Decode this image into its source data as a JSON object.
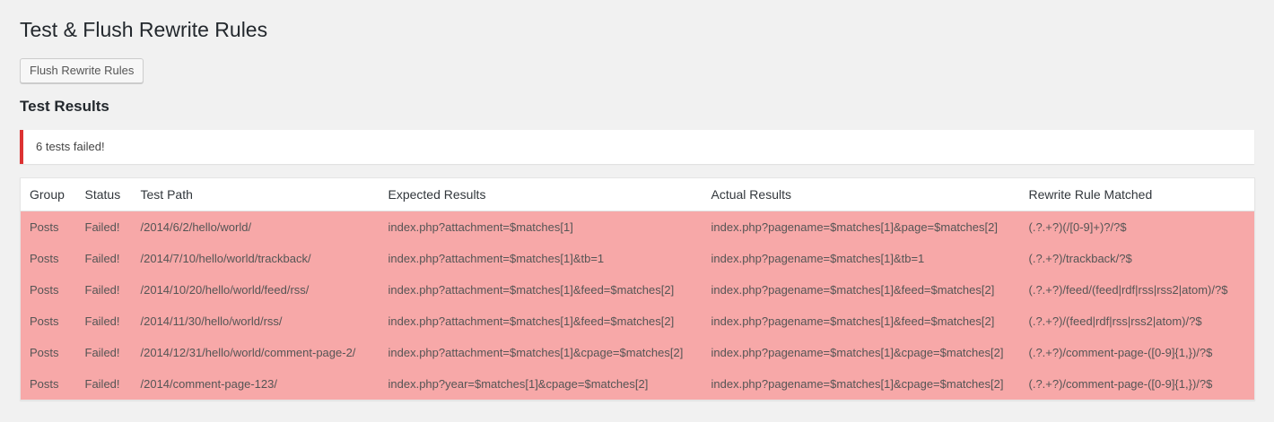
{
  "page": {
    "title": "Test & Flush Rewrite Rules",
    "flush_button_label": "Flush Rewrite Rules",
    "section_title": "Test Results"
  },
  "notice": {
    "message": "6 tests failed!",
    "color": "#dc3232"
  },
  "table": {
    "row_color": "#f7a8a8",
    "columns": [
      "Group",
      "Status",
      "Test Path",
      "Expected Results",
      "Actual Results",
      "Rewrite Rule Matched"
    ],
    "rows": [
      [
        "Posts",
        "Failed!",
        "/2014/6/2/hello/world/",
        "index.php?attachment=$matches[1]",
        "index.php?pagename=$matches[1]&page=$matches[2]",
        "(.?.+?)(/[0-9]+)?/?$"
      ],
      [
        "Posts",
        "Failed!",
        "/2014/7/10/hello/world/trackback/",
        "index.php?attachment=$matches[1]&tb=1",
        "index.php?pagename=$matches[1]&tb=1",
        "(.?.+?)/trackback/?$"
      ],
      [
        "Posts",
        "Failed!",
        "/2014/10/20/hello/world/feed/rss/",
        "index.php?attachment=$matches[1]&feed=$matches[2]",
        "index.php?pagename=$matches[1]&feed=$matches[2]",
        "(.?.+?)/feed/(feed|rdf|rss|rss2|atom)/?$"
      ],
      [
        "Posts",
        "Failed!",
        "/2014/11/30/hello/world/rss/",
        "index.php?attachment=$matches[1]&feed=$matches[2]",
        "index.php?pagename=$matches[1]&feed=$matches[2]",
        "(.?.+?)/(feed|rdf|rss|rss2|atom)/?$"
      ],
      [
        "Posts",
        "Failed!",
        "/2014/12/31/hello/world/comment-page-2/",
        "index.php?attachment=$matches[1]&cpage=$matches[2]",
        "index.php?pagename=$matches[1]&cpage=$matches[2]",
        "(.?.+?)/comment-page-([0-9]{1,})/?$"
      ],
      [
        "Posts",
        "Failed!",
        "/2014/comment-page-123/",
        "index.php?year=$matches[1]&cpage=$matches[2]",
        "index.php?pagename=$matches[1]&cpage=$matches[2]",
        "(.?.+?)/comment-page-([0-9]{1,})/?$"
      ]
    ]
  }
}
